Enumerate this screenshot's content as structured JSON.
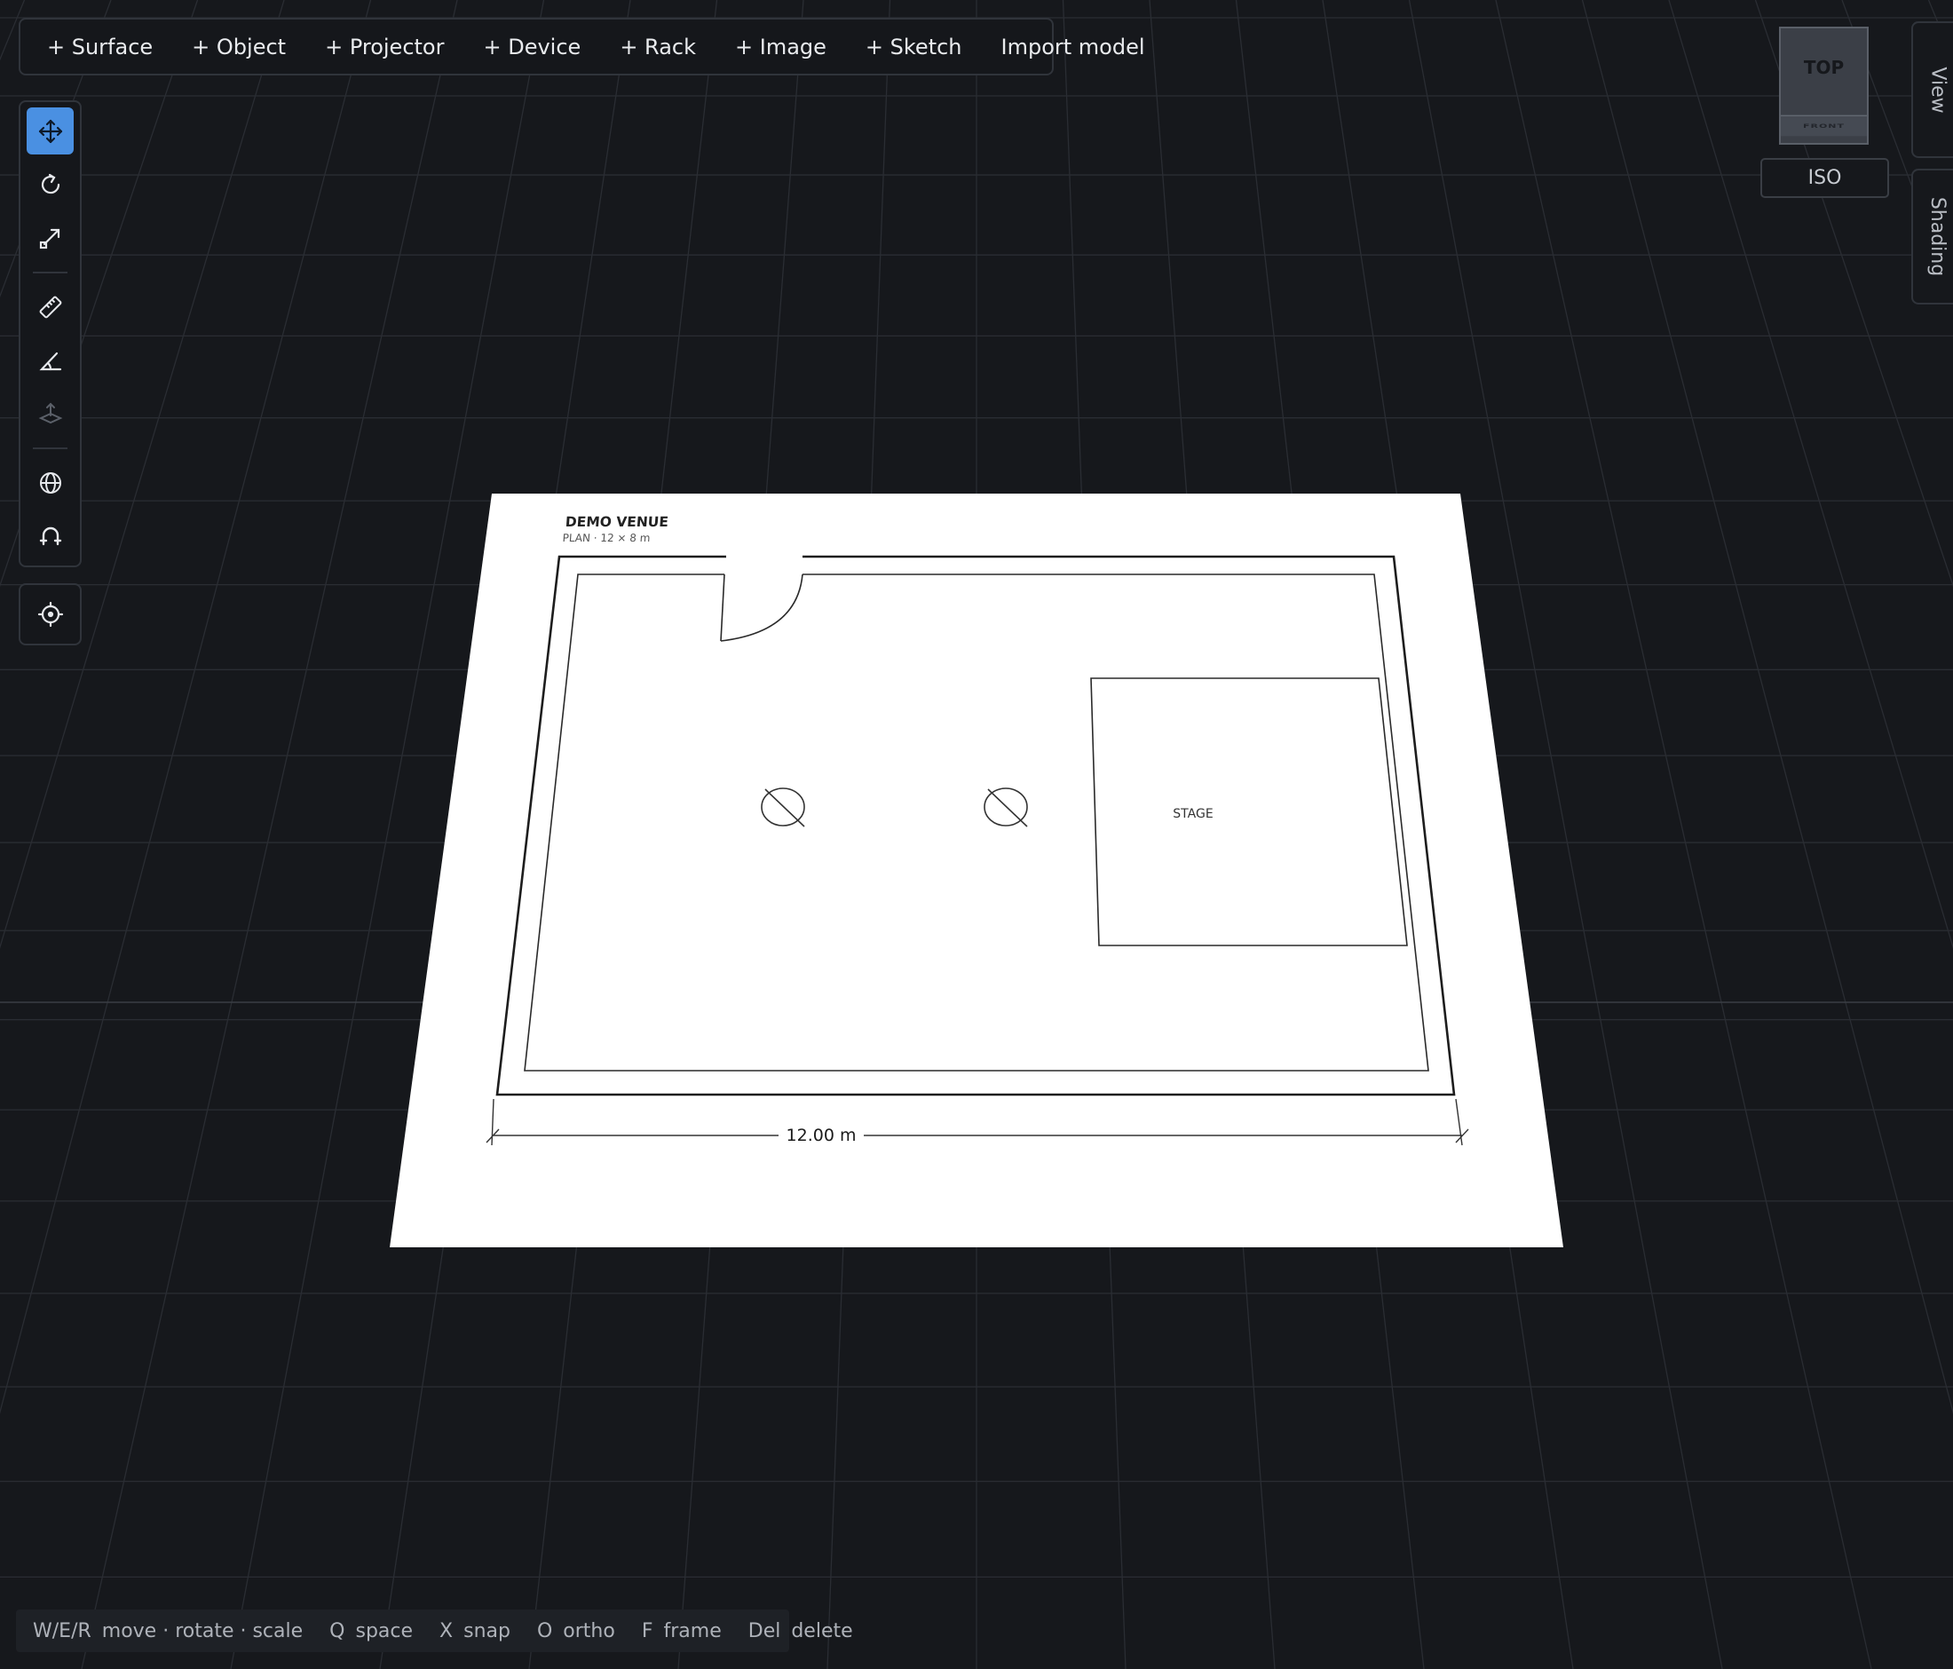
{
  "toolbar": {
    "items": [
      "+ Surface",
      "+ Object",
      "+ Projector",
      "+ Device",
      "+ Rack",
      "+ Image",
      "+ Sketch",
      "Import model"
    ]
  },
  "tools": {
    "active": "move",
    "items": [
      "move-icon",
      "rotate-icon",
      "scale-icon",
      "ruler-icon",
      "angle-icon",
      "elevation-icon",
      "globe-icon",
      "magnet-icon",
      "crosshair-icon"
    ]
  },
  "viewcube": {
    "top": "TOP",
    "front": "FRONT",
    "iso": "ISO"
  },
  "side_tabs": {
    "view": "View",
    "shading": "Shading"
  },
  "plan": {
    "title": "DEMO VENUE",
    "subtitle": "PLAN · 12 × 8 m",
    "stage_label": "STAGE",
    "dimension_label": "12.00 m"
  },
  "status": {
    "hints": [
      {
        "key": "W/E/R",
        "action": "move · rotate · scale"
      },
      {
        "key": "Q",
        "action": "space"
      },
      {
        "key": "X",
        "action": "snap"
      },
      {
        "key": "O",
        "action": "ortho"
      },
      {
        "key": "F",
        "action": "frame"
      },
      {
        "key": "Del",
        "action": "delete"
      }
    ]
  },
  "colors": {
    "background": "#16181c",
    "grid": "#2a2d33",
    "accent": "#4a90e2",
    "paper": "#ffffff",
    "ink": "#222222"
  }
}
